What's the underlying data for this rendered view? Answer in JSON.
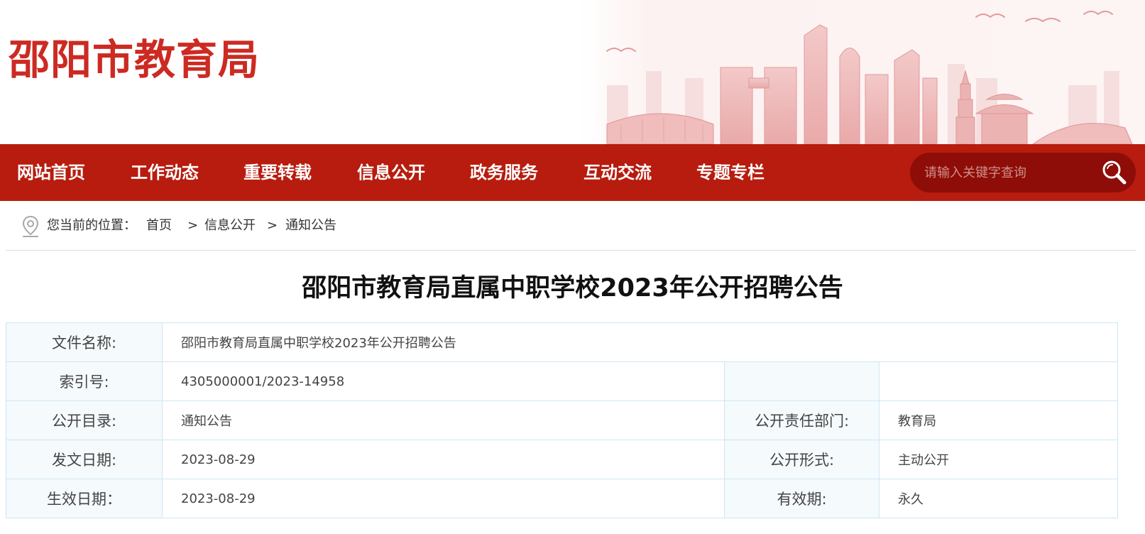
{
  "header": {
    "logo_text": "邵阳市教育局",
    "brand_color": "#cc2a22"
  },
  "nav": {
    "bar_color": "#b71c0e",
    "items": [
      {
        "label": "网站首页"
      },
      {
        "label": "工作动态"
      },
      {
        "label": "重要转载"
      },
      {
        "label": "信息公开"
      },
      {
        "label": "政务服务"
      },
      {
        "label": "互动交流"
      },
      {
        "label": "专题专栏"
      }
    ],
    "search": {
      "placeholder": "请输入关键字查询",
      "icon": "search-icon"
    }
  },
  "breadcrumb": {
    "icon": "location-pin-icon",
    "prefix": "您当前的位置：",
    "separator": ">",
    "items": [
      "首页",
      "信息公开",
      "通知公告"
    ]
  },
  "article": {
    "title": "邵阳市教育局直属中职学校2023年公开招聘公告"
  },
  "info": {
    "file_name_label": "文件名称:",
    "file_name_value": "邵阳市教育局直属中职学校2023年公开招聘公告",
    "index_label": "索引号:",
    "index_value": "4305000001/2023-14958",
    "catalog_label": "公开目录:",
    "catalog_value": "通知公告",
    "dept_label": "公开责任部门:",
    "dept_value": "教育局",
    "issue_date_label": "发文日期:",
    "issue_date_value": "2023-08-29",
    "form_label": "公开形式:",
    "form_value": "主动公开",
    "effective_date_label": "生效日期：",
    "effective_date_value": "2023-08-29",
    "validity_label": "有效期:",
    "validity_value": "永久"
  }
}
